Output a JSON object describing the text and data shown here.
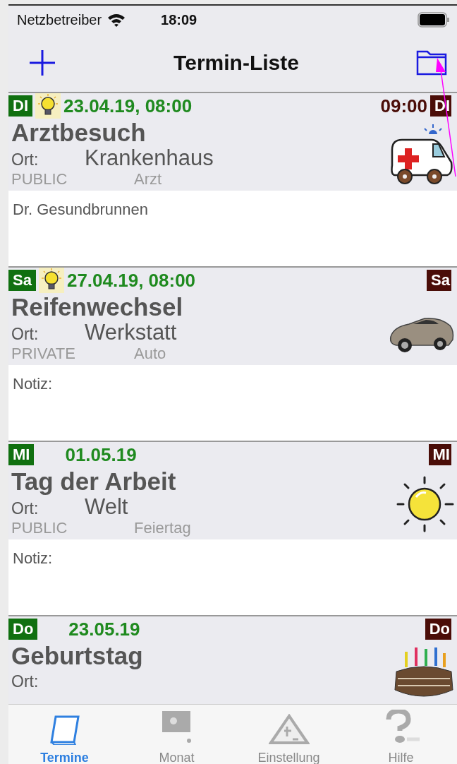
{
  "status_bar": {
    "carrier": "Netzbetreiber",
    "time": "18:09"
  },
  "nav": {
    "title": "Termin-Liste"
  },
  "appointments": [
    {
      "day_left": "DI",
      "reminder": true,
      "date": "23.04.19, 08:00",
      "end_time": "09:00",
      "day_right": "DI",
      "title": "Arztbesuch",
      "place_label": "Ort:",
      "place": "Krankenhaus",
      "visibility": "PUBLIC",
      "category": "Arzt",
      "kind": "ambulance",
      "note": "Dr. Gesundbrunnen"
    },
    {
      "day_left": "Sa",
      "reminder": true,
      "date": "27.04.19, 08:00",
      "day_right": "Sa",
      "title": "Reifenwechsel",
      "place_label": "Ort:",
      "place": "Werkstatt",
      "visibility": "PRIVATE",
      "category": "Auto",
      "kind": "car",
      "note": "Notiz:"
    },
    {
      "day_left": "MI",
      "reminder": false,
      "date": "01.05.19",
      "day_right": "MI",
      "title": "Tag der Arbeit",
      "place_label": "Ort:",
      "place": "Welt",
      "visibility": "PUBLIC",
      "category": "Feiertag",
      "kind": "sun",
      "note": "Notiz:"
    },
    {
      "day_left": "Do",
      "reminder": false,
      "date": "23.05.19",
      "day_right": "Do",
      "title": "Geburtstag",
      "place_label": "Ort:",
      "kind": "cake"
    }
  ],
  "tabs": [
    {
      "label": "Termine",
      "kind": "calendar",
      "selected": true
    },
    {
      "label": "Monat",
      "kind": "board",
      "selected": false
    },
    {
      "label": "Einstellung",
      "kind": "roadwork",
      "selected": false
    },
    {
      "label": "Hilfe",
      "kind": "question",
      "selected": false
    }
  ]
}
